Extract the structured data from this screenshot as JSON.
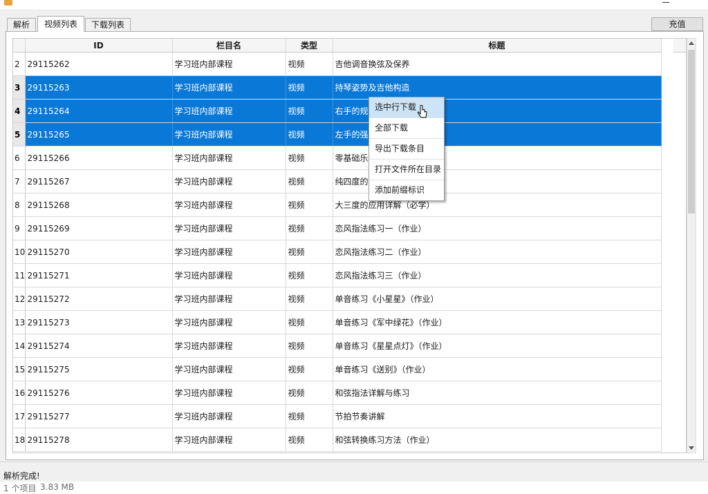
{
  "window": {
    "title": ""
  },
  "tabs": [
    {
      "label": "解析"
    },
    {
      "label": "视频列表"
    },
    {
      "label": "下载列表"
    }
  ],
  "toolbar": {
    "recharge_label": "充值"
  },
  "table": {
    "columns": [
      "",
      "ID",
      "栏目名",
      "类型",
      "标题"
    ],
    "rows": [
      {
        "num": "2",
        "id": "29115262",
        "column": "学习班内部课程",
        "type": "视频",
        "title": "吉他调音换弦及保养"
      },
      {
        "num": "3",
        "id": "29115263",
        "column": "学习班内部课程",
        "type": "视频",
        "title": "持琴姿势及吉他构造"
      },
      {
        "num": "4",
        "id": "29115264",
        "column": "学习班内部课程",
        "type": "视频",
        "title": "右手的规"
      },
      {
        "num": "5",
        "id": "29115265",
        "column": "学习班内部课程",
        "type": "视频",
        "title": "左手的强"
      },
      {
        "num": "6",
        "id": "29115266",
        "column": "学习班内部课程",
        "type": "视频",
        "title": "零基础乐"
      },
      {
        "num": "7",
        "id": "29115267",
        "column": "学习班内部课程",
        "type": "视频",
        "title": "纯四度的"
      },
      {
        "num": "8",
        "id": "29115268",
        "column": "学习班内部课程",
        "type": "视频",
        "title": "大三度的应用详解（必学）"
      },
      {
        "num": "9",
        "id": "29115269",
        "column": "学习班内部课程",
        "type": "视频",
        "title": "恋风指法练习一（作业）"
      },
      {
        "num": "10",
        "id": "29115270",
        "column": "学习班内部课程",
        "type": "视频",
        "title": "恋风指法练习二（作业）"
      },
      {
        "num": "11",
        "id": "29115271",
        "column": "学习班内部课程",
        "type": "视频",
        "title": "恋风指法练习三（作业）"
      },
      {
        "num": "12",
        "id": "29115272",
        "column": "学习班内部课程",
        "type": "视频",
        "title": "单音练习《小星星》（作业）"
      },
      {
        "num": "13",
        "id": "29115273",
        "column": "学习班内部课程",
        "type": "视频",
        "title": "单音练习《军中绿花》（作业）"
      },
      {
        "num": "14",
        "id": "29115274",
        "column": "学习班内部课程",
        "type": "视频",
        "title": "单音练习《星星点灯》（作业）"
      },
      {
        "num": "15",
        "id": "29115275",
        "column": "学习班内部课程",
        "type": "视频",
        "title": "单音练习《送别》（作业）"
      },
      {
        "num": "16",
        "id": "29115276",
        "column": "学习班内部课程",
        "type": "视频",
        "title": "和弦指法详解与练习"
      },
      {
        "num": "17",
        "id": "29115277",
        "column": "学习班内部课程",
        "type": "视频",
        "title": "节拍节奏讲解"
      },
      {
        "num": "18",
        "id": "29115278",
        "column": "学习班内部课程",
        "type": "视频",
        "title": "和弦转换练习方法（作业）"
      }
    ]
  },
  "context_menu": {
    "items": [
      "选中行下载",
      "全部下载",
      "导出下载条目",
      "打开文件所在目录",
      "添加前缀标识"
    ]
  },
  "status": {
    "message": "解析完成!",
    "item_count": "1 个项目",
    "item_size": "3.83 MB"
  },
  "colors": {
    "selection": "#0a78d7",
    "menu_hover": "#cce4f7"
  }
}
